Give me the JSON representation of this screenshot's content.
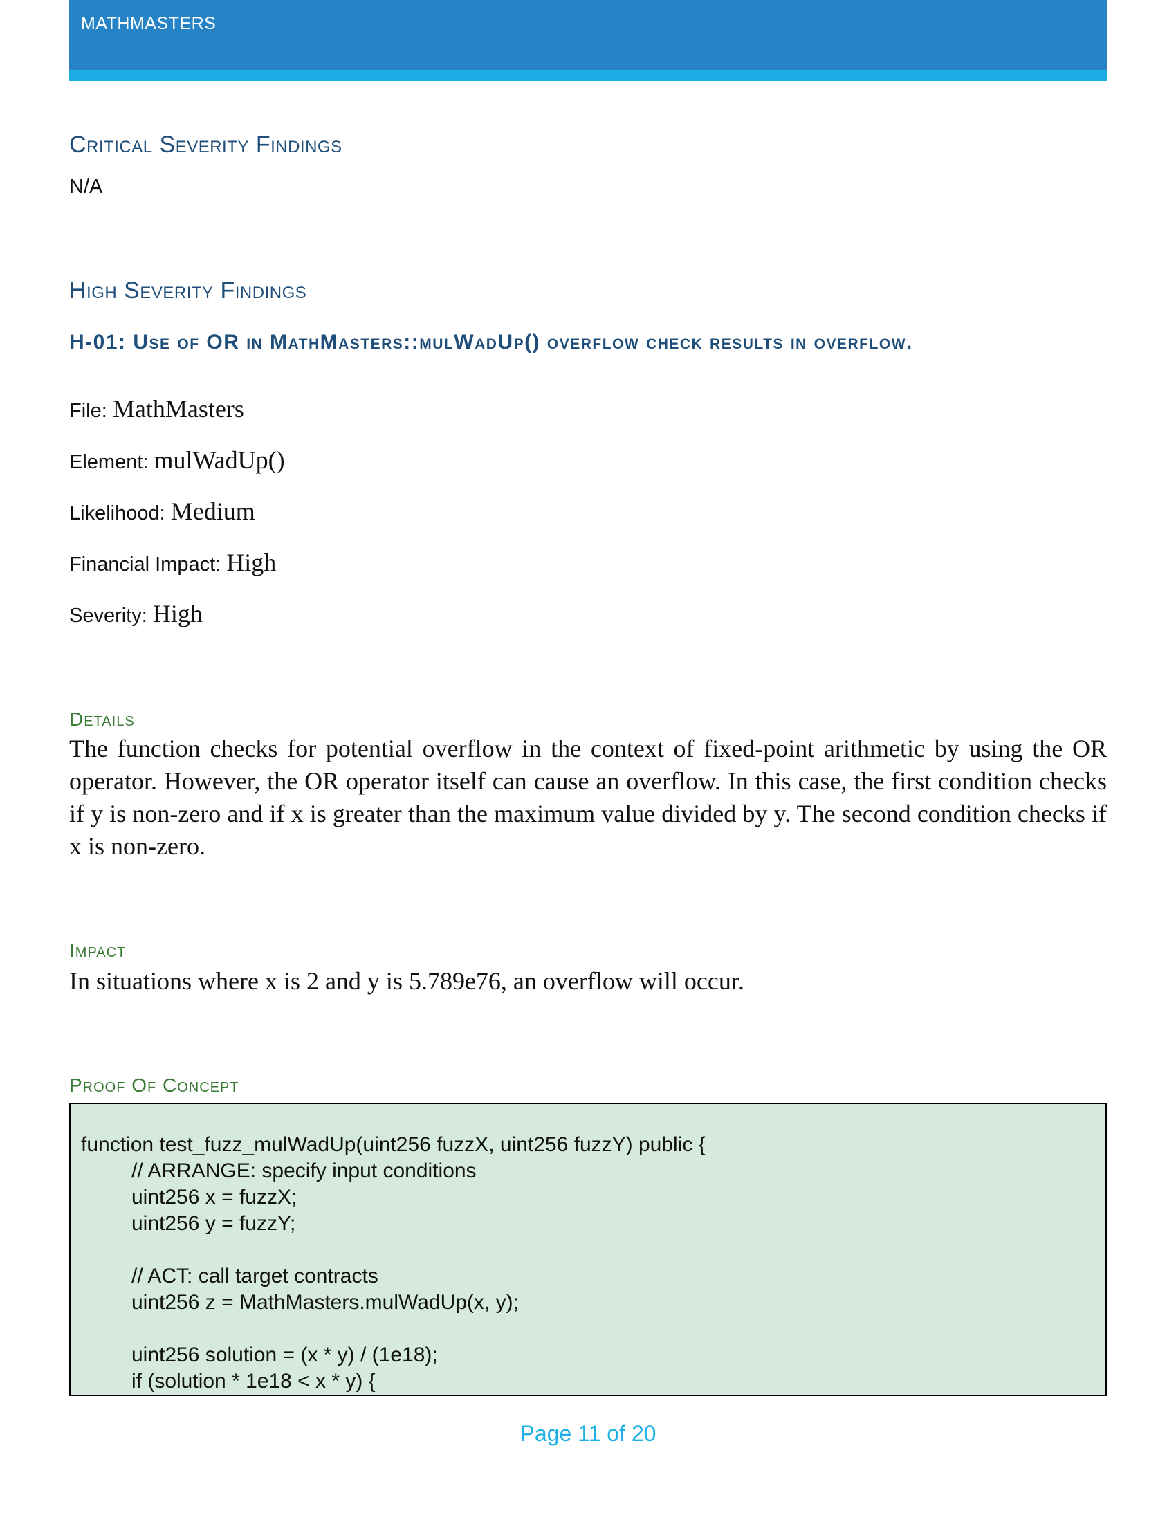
{
  "header": {
    "title": "MATHMASTERS"
  },
  "critical": {
    "heading": "Critical Severity Findings",
    "value": "N/A"
  },
  "high": {
    "heading": "High Severity Findings"
  },
  "finding": {
    "title": "H-01: Use of OR in MathMasters::mulWadUp() overflow check results in overflow.",
    "file_label": "File:",
    "file_value": "MathMasters",
    "element_label": "Element:",
    "element_value": "mulWadUp()",
    "likelihood_label": "Likelihood:",
    "likelihood_value": "Medium",
    "financial_label": "Financial Impact:",
    "financial_value": "High",
    "severity_label": "Severity:",
    "severity_value": "High"
  },
  "details": {
    "heading": "Details",
    "text": "The function checks for potential overflow in the context of fixed-point arithmetic by using the OR operator. However, the OR operator itself can cause an overflow. In this case, the first condition checks if y is non-zero and if x is greater than the maximum value divided by y. The second condition checks if x is non-zero."
  },
  "impact": {
    "heading": "Impact",
    "text": "In situations where x is 2 and y is 5.789e76, an overflow will occur."
  },
  "poc": {
    "heading": "Proof Of Concept",
    "lines": [
      "function test_fuzz_mulWadUp(uint256 fuzzX, uint256 fuzzY) public {",
      "// ARRANGE: specify input conditions",
      "uint256 x = fuzzX;",
      "uint256 y = fuzzY;",
      "// ACT: call target contracts",
      "uint256 z = MathMasters.mulWadUp(x, y);",
      "uint256 solution = (x * y) / (1e18);",
      "if (solution * 1e18 < x * y) {"
    ]
  },
  "footer": {
    "page": "Page 11 of 20"
  }
}
